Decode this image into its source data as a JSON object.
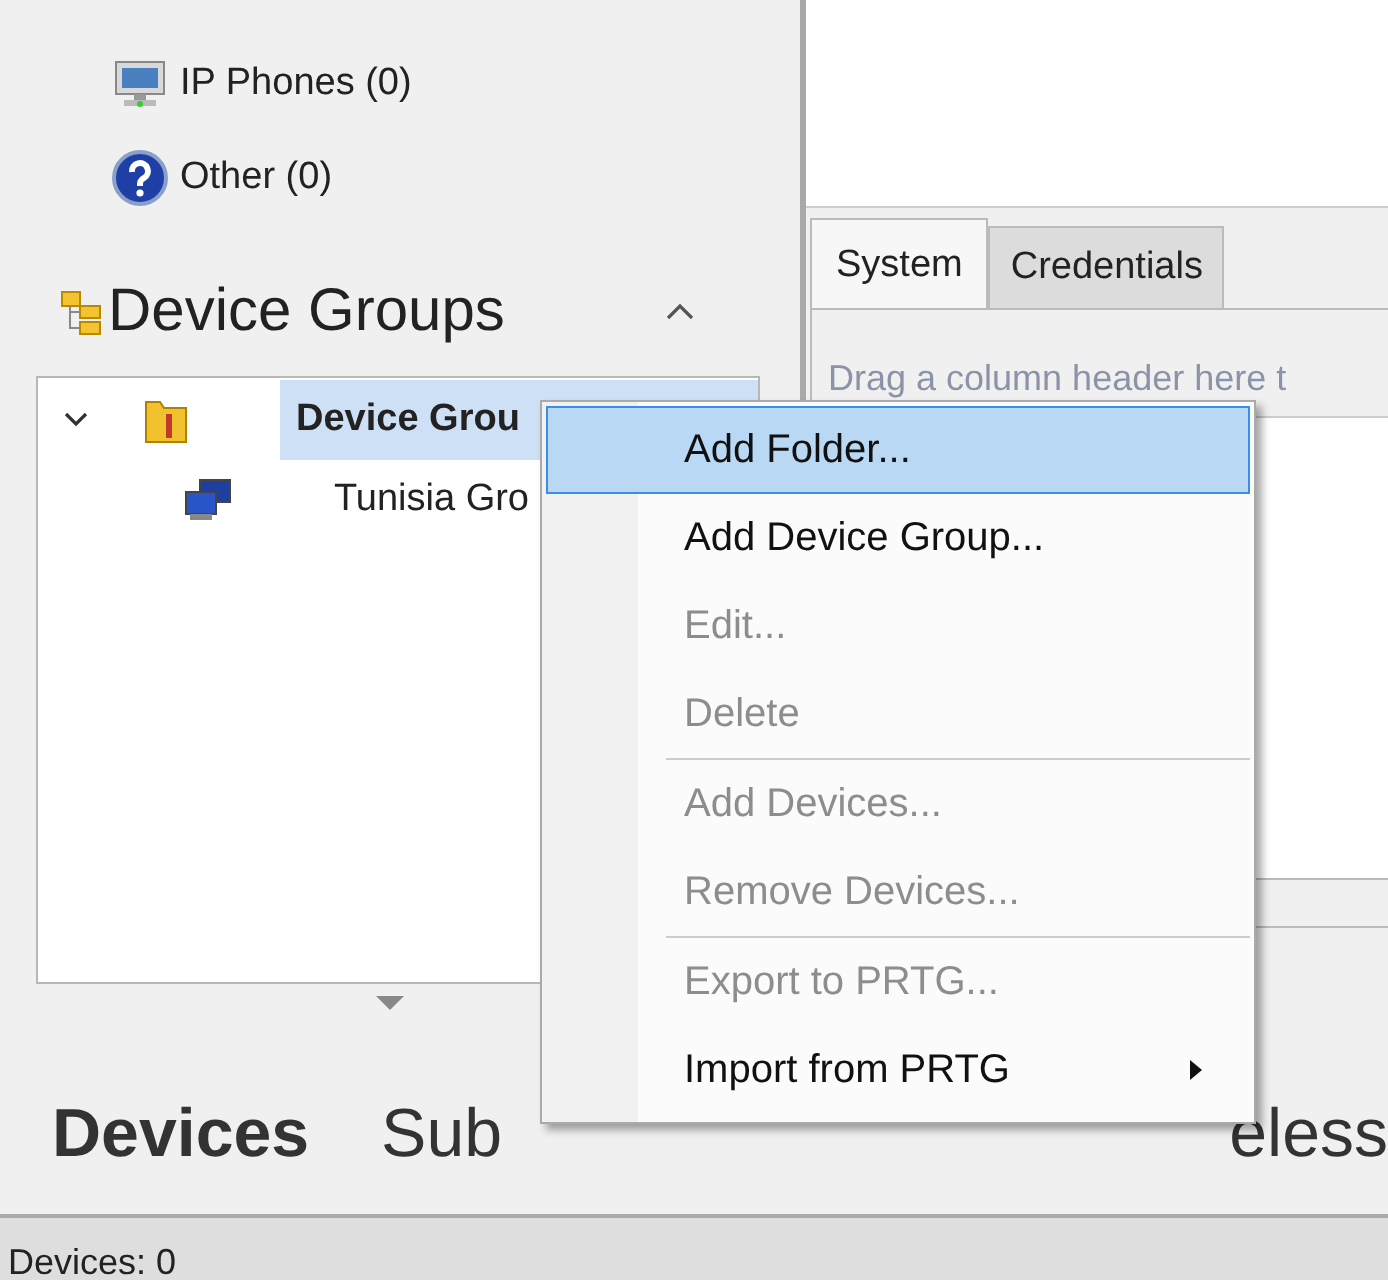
{
  "sidebar": {
    "items": [
      {
        "label": "IP Phones (0)",
        "kind": "phone"
      },
      {
        "label": "Other (0)",
        "kind": "other"
      }
    ],
    "section": {
      "title": "Device Groups",
      "expanded": true
    },
    "tree": [
      {
        "label": "Device Grou",
        "expanded": true,
        "selected": true,
        "children": [
          {
            "label": "Tunisia Gro",
            "selected": false
          }
        ]
      }
    ]
  },
  "detail": {
    "tabs": [
      {
        "label": "System",
        "selected": true
      },
      {
        "label": "Credentials",
        "selected": false
      }
    ],
    "hint": "Drag a column header here t"
  },
  "bottom_tabs": [
    {
      "label": "Devices",
      "selected": true
    },
    {
      "label": "Sub",
      "selected": false
    },
    {
      "label": "eless",
      "selected": false
    }
  ],
  "status_bar": "Devices: 0",
  "context_menu": [
    {
      "kind": "item",
      "label": "Add Folder...",
      "disabled": false,
      "selected": true
    },
    {
      "kind": "item",
      "label": "Add Device Group...",
      "disabled": false,
      "selected": false
    },
    {
      "kind": "item",
      "label": "Edit...",
      "disabled": true,
      "selected": false
    },
    {
      "kind": "item",
      "label": "Delete",
      "disabled": true,
      "selected": false
    },
    {
      "kind": "separator"
    },
    {
      "kind": "item",
      "label": "Add Devices...",
      "disabled": true,
      "selected": false
    },
    {
      "kind": "item",
      "label": "Remove Devices...",
      "disabled": true,
      "selected": false
    },
    {
      "kind": "separator"
    },
    {
      "kind": "item",
      "label": "Export to PRTG...",
      "disabled": true,
      "selected": false
    },
    {
      "kind": "item",
      "label": "Import from PRTG",
      "disabled": false,
      "selected": false,
      "submenu": true
    }
  ]
}
